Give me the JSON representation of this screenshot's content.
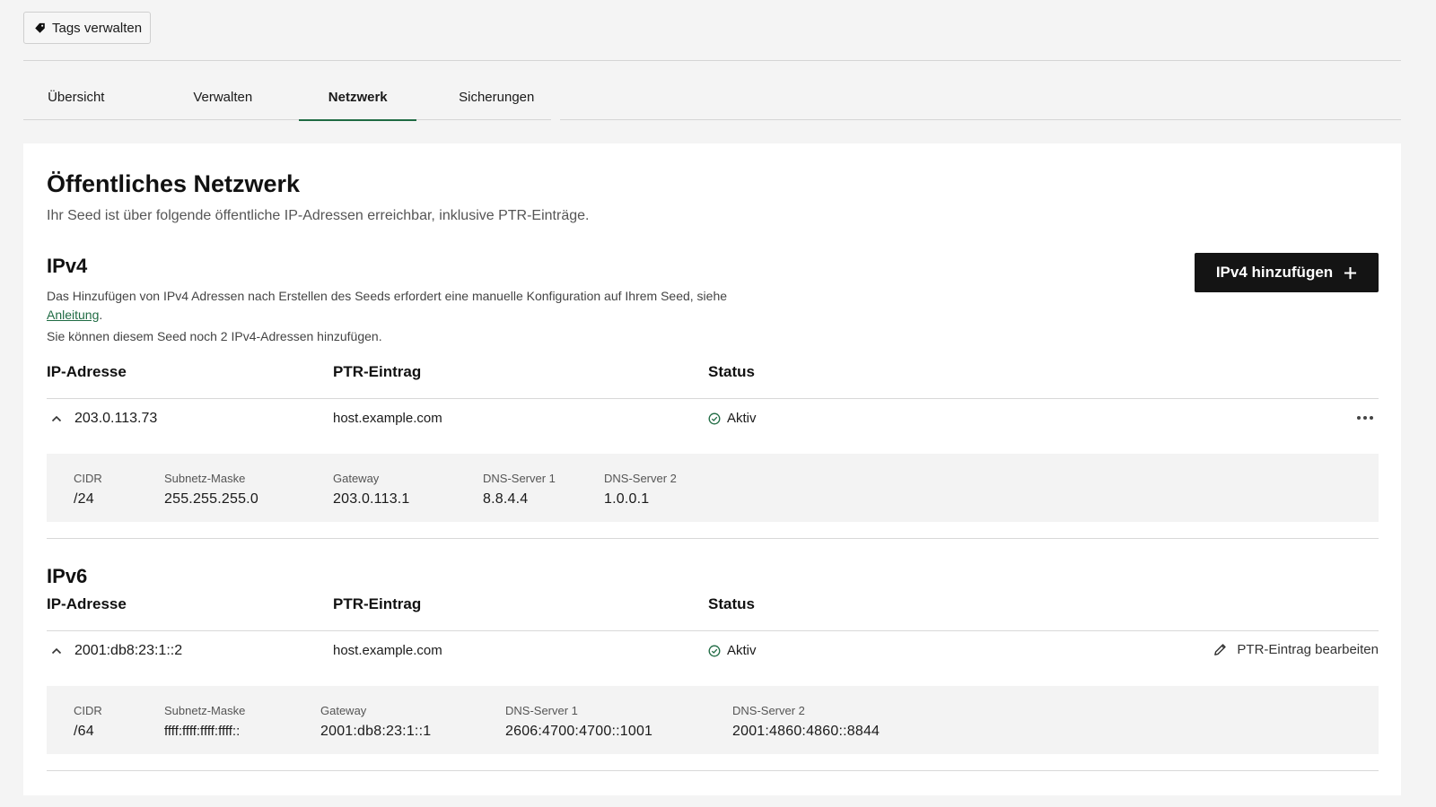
{
  "header": {
    "tags_button_label": "Tags verwalten"
  },
  "tabs": [
    {
      "label": "Übersicht",
      "active": false
    },
    {
      "label": "Verwalten",
      "active": false
    },
    {
      "label": "Netzwerk",
      "active": true
    },
    {
      "label": "Sicherungen",
      "active": false
    }
  ],
  "public_network": {
    "title": "Öffentliches Netzwerk",
    "subtitle": "Ihr Seed ist über folgende öffentliche IP-Adressen erreichbar, inklusive PTR-Einträge."
  },
  "ipv4": {
    "heading": "IPv4",
    "add_button_label": "IPv4 hinzufügen",
    "note_text": "Das Hinzufügen von IPv4 Adressen nach Erstellen des Seeds erfordert eine manuelle Konfiguration auf Ihrem Seed, siehe",
    "note_link": "Anleitung",
    "note_end": ".",
    "remaining_text": "Sie können diesem Seed noch 2 IPv4-Adressen hinzufügen.",
    "columns": {
      "ip": "IP-Adresse",
      "ptr": "PTR-Eintrag",
      "status": "Status"
    },
    "row": {
      "ip": "203.0.113.73",
      "ptr": "host.example.com",
      "status": "Aktiv",
      "details": [
        {
          "label": "CIDR",
          "value": "/24"
        },
        {
          "label": "Subnetz-Maske",
          "value": "255.255.255.0"
        },
        {
          "label": "Gateway",
          "value": "203.0.113.1"
        },
        {
          "label": "DNS-Server 1",
          "value": "8.8.4.4"
        },
        {
          "label": "DNS-Server 2",
          "value": "1.0.0.1"
        }
      ]
    }
  },
  "ipv6": {
    "heading": "IPv6",
    "columns": {
      "ip": "IP-Adresse",
      "ptr": "PTR-Eintrag",
      "status": "Status"
    },
    "row": {
      "ip": "2001:db8:23:1::2",
      "ptr": "host.example.com",
      "status": "Aktiv",
      "edit_label": "PTR-Eintrag bearbeiten",
      "details": [
        {
          "label": "CIDR",
          "value": "/64"
        },
        {
          "label": "Subnetz-Maske",
          "value": "ffff:ffff:ffff:ffff::"
        },
        {
          "label": "Gateway",
          "value": "2001:db8:23:1::1"
        },
        {
          "label": "DNS-Server 1",
          "value": "2606:4700:4700::1001"
        },
        {
          "label": "DNS-Server 2",
          "value": "2001:4860:4860::8844"
        }
      ]
    }
  },
  "colors": {
    "accent": "#1f6b43",
    "button_dark": "#141414",
    "status_ok": "#1f6b43"
  }
}
